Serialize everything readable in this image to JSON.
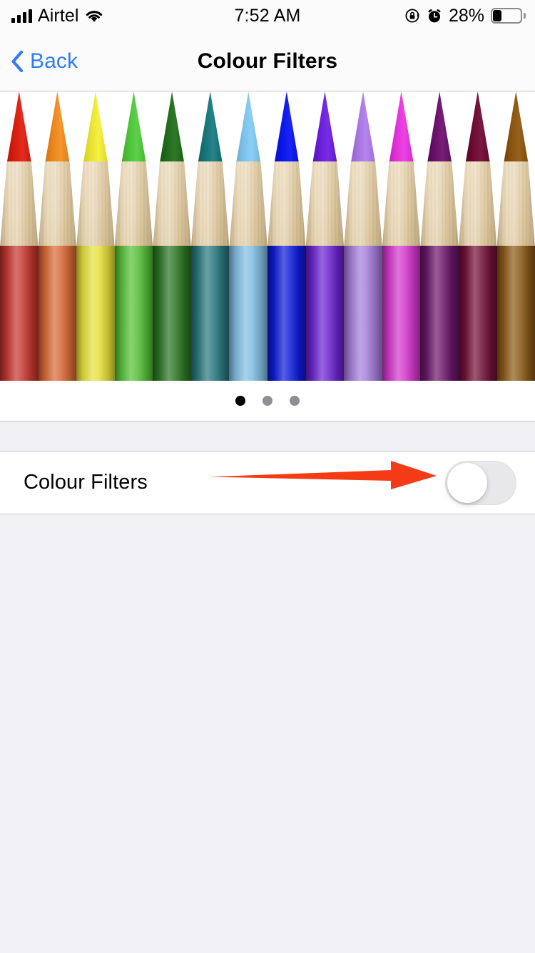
{
  "status_bar": {
    "carrier": "Airtel",
    "time": "7:52 AM",
    "battery_percent": "28%",
    "battery_level": 28,
    "signal_bars": 4,
    "icons": [
      "signal-bars-icon",
      "wifi-icon",
      "rotation-lock-icon",
      "alarm-clock-icon",
      "battery-icon"
    ]
  },
  "nav_bar": {
    "back_label": "Back",
    "title": "Colour Filters",
    "back_tint": "#2f7cf6"
  },
  "image_card": {
    "alt": "row of coloured pencils",
    "pencils": [
      {
        "tip": "#d51f0e",
        "barrel": "#c5362f"
      },
      {
        "tip": "#e8871e",
        "barrel": "#d96a37"
      },
      {
        "tip": "#e8e234",
        "barrel": "#e6e13c"
      },
      {
        "tip": "#4fc23c",
        "barrel": "#56c03a"
      },
      {
        "tip": "#216b1c",
        "barrel": "#2c7524"
      },
      {
        "tip": "#18757a",
        "barrel": "#29787e"
      },
      {
        "tip": "#7dc0e8",
        "barrel": "#82bde2"
      },
      {
        "tip": "#0a17e6",
        "barrel": "#0c1ad8"
      },
      {
        "tip": "#6a1fd8",
        "barrel": "#6a24cf"
      },
      {
        "tip": "#a876e0",
        "barrel": "#a67ddc"
      },
      {
        "tip": "#e033d8",
        "barrel": "#d538cc"
      },
      {
        "tip": "#691068",
        "barrel": "#6b1669"
      },
      {
        "tip": "#6c0b33",
        "barrel": "#701137"
      },
      {
        "tip": "#8a5410",
        "barrel": "#8c5a17"
      }
    ],
    "page_dots": {
      "count": 3,
      "active_index": 0
    }
  },
  "settings": {
    "toggle_row": {
      "label": "Colour Filters",
      "switch_state": "off",
      "track_color_off": "#e8e8ea",
      "knob_color": "#ffffff"
    }
  },
  "annotation": {
    "type": "arrow",
    "color": "#f53b16",
    "points_to": "colour-filters-switch"
  }
}
